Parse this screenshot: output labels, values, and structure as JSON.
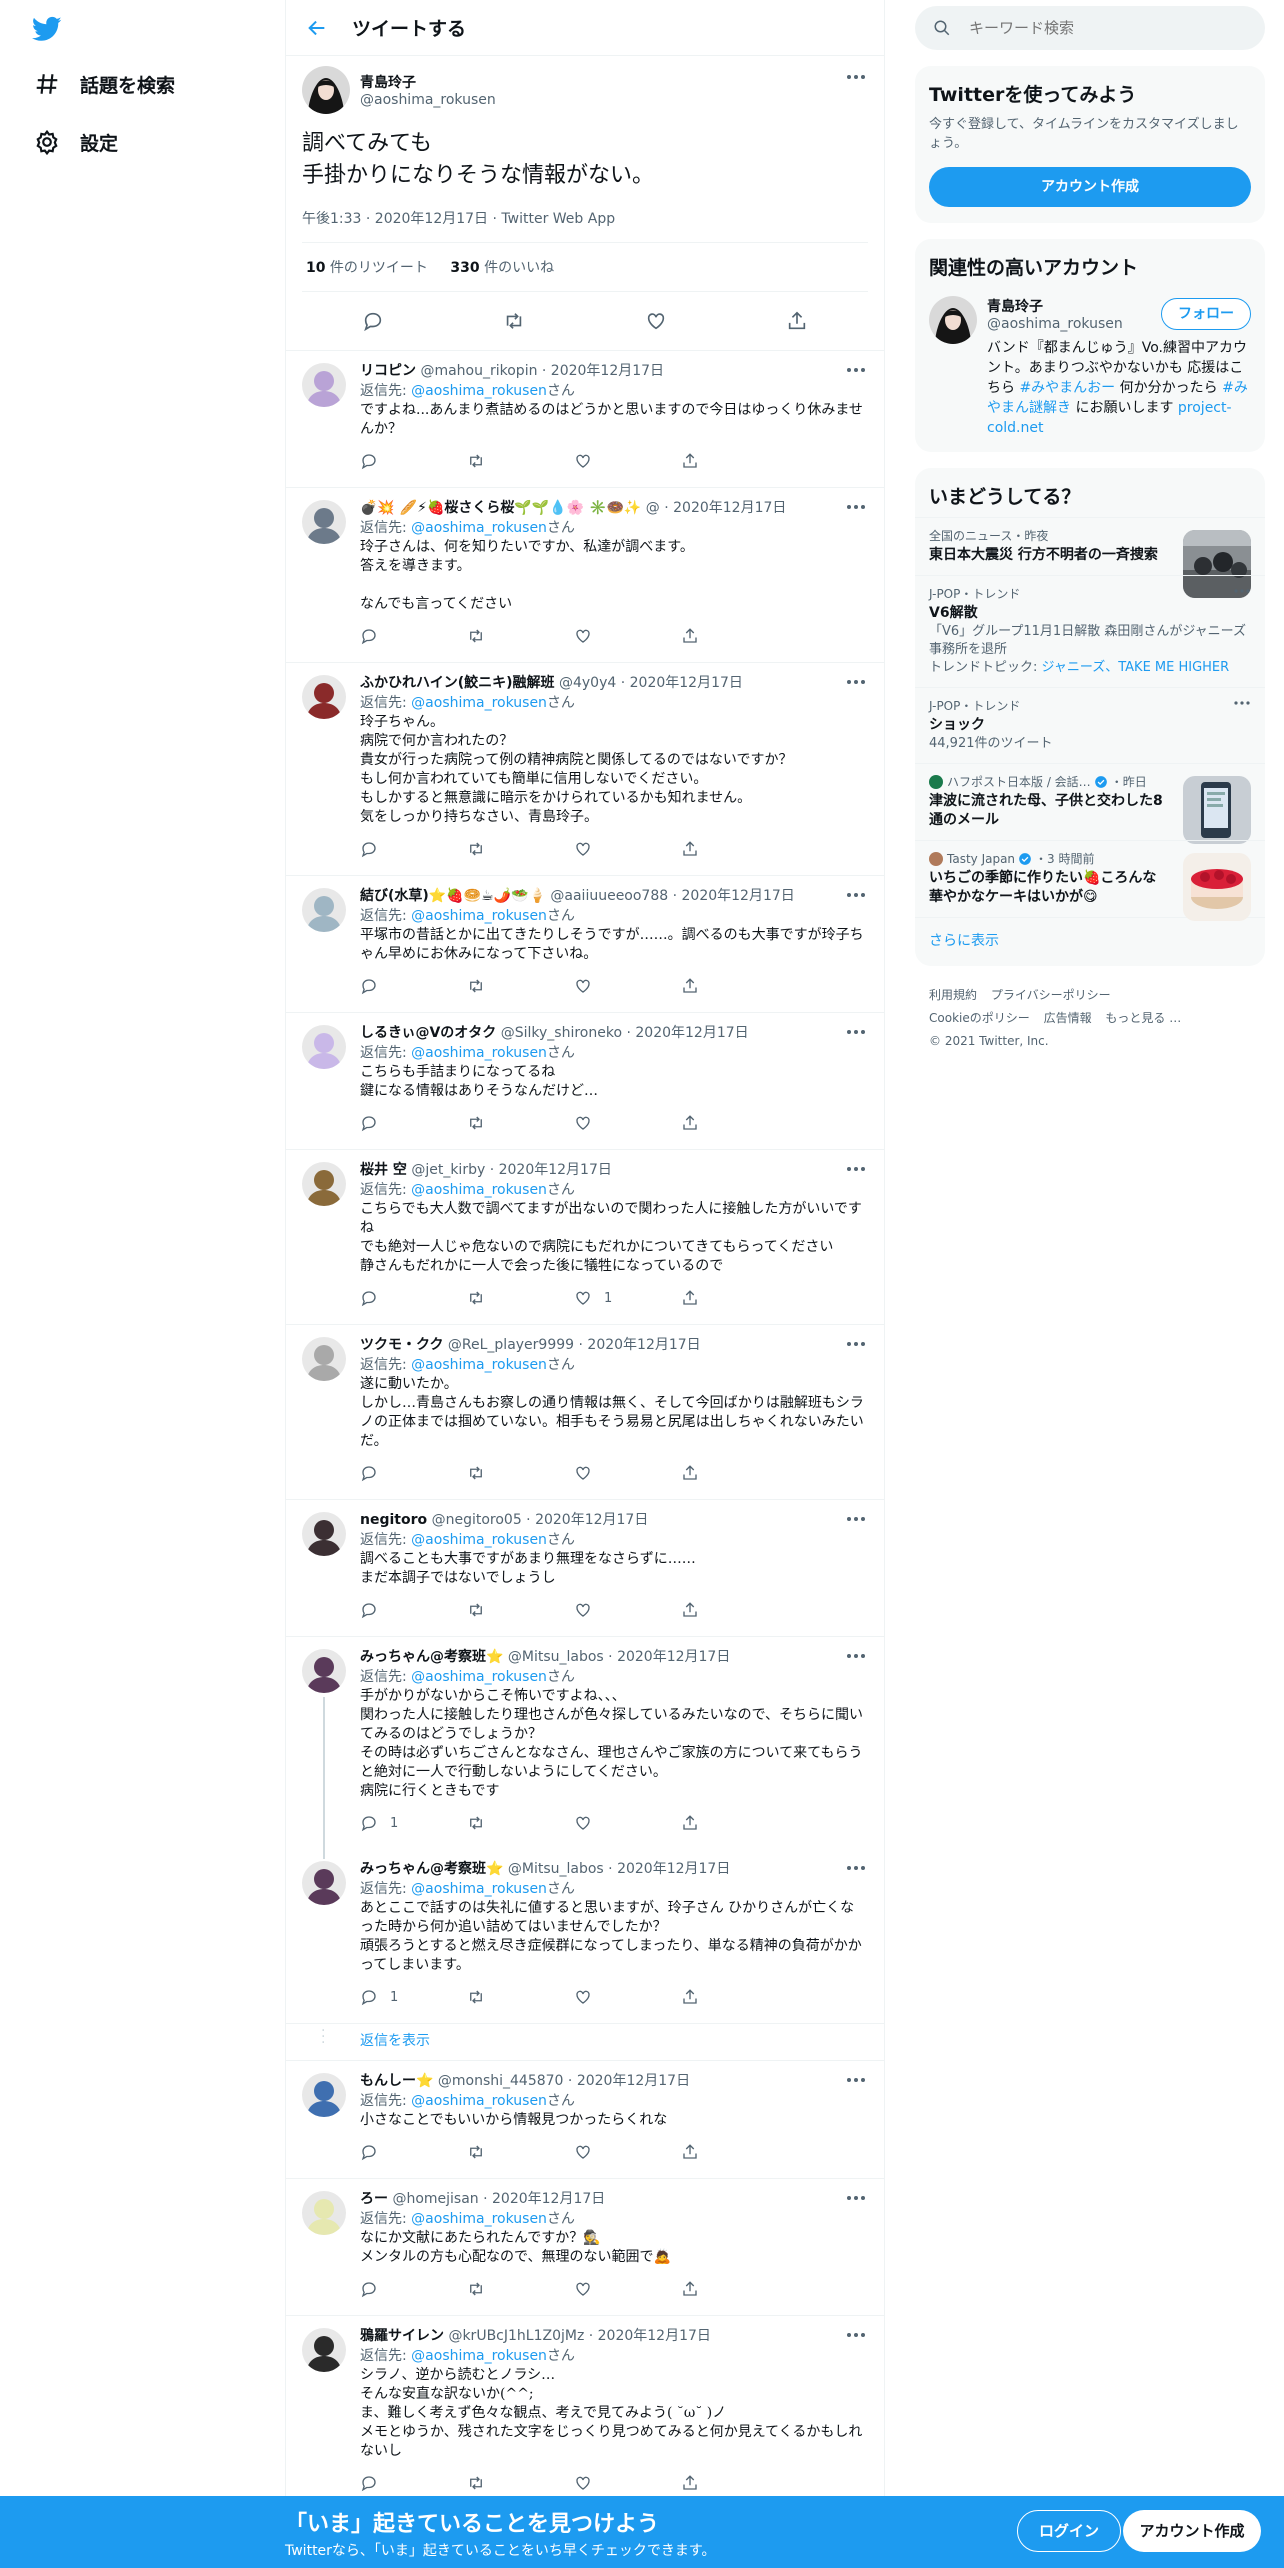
{
  "nav": {
    "logo_icon": "twitter-bird-icon",
    "explore_label": "話題を検索",
    "settings_label": "設定"
  },
  "header": {
    "title": "ツイートする"
  },
  "focal": {
    "name": "青島玲子",
    "handle": "@aoshima_rokusen",
    "text": "調べてみても\n手掛かりになりそうな情報がない。",
    "meta": "午後1:33 · 2020年12月17日 · Twitter Web App",
    "retweets": "10",
    "retweets_label": " 件のリツイート",
    "likes": "330",
    "likes_label": " 件のいいね"
  },
  "reply_prefix": "返信先: ",
  "reply_suffix": "さん",
  "show_replies_label": "返信を表示",
  "tweets": [
    {
      "name": "リコピン",
      "handle": "@mahou_rikopin · 2020年12月17日",
      "reply_to": "@aoshima_rokusen",
      "text": "ですよね...あんまり煮詰めるのはどうかと思いますので今日はゆっくり休みませんか？",
      "reply_count": "",
      "like_count": ""
    },
    {
      "name": "💣💥 🥖⚡🍓桜さくら桜🌱🌱💧🌸 ✳️🍩✨",
      "handle": "@ · 2020年12月17日",
      "reply_to": "@aoshima_rokusen",
      "text": "玲子さんは、何を知りたいですか、私達が調べます。\n答えを導きます。\n\nなんでも言ってください",
      "reply_count": "",
      "like_count": ""
    },
    {
      "name": "ふかひれハイン(鮫ニキ)融解班",
      "handle": "@4y0y4 · 2020年12月17日",
      "reply_to": "@aoshima_rokusen",
      "text": "玲子ちゃん。\n病院で何か言われたの？\n貴女が行った病院って例の精神病院と関係してるのではないですか？\nもし何か言われていても簡単に信用しないでください。\nもしかすると無意識に暗示をかけられているかも知れません。\n気をしっかり持ちなさい、青島玲子。",
      "reply_count": "",
      "like_count": ""
    },
    {
      "name": "結び(水草)⭐🍓🥯☕🌶️🥗🍦",
      "handle": "@aaiiuueeoo788 · 2020年12月17日",
      "reply_to": "@aoshima_rokusen",
      "text": "平塚市の昔話とかに出てきたりしそうですが……。調べるのも大事ですが玲子ちゃん早めにお休みになって下さいね。",
      "reply_count": "",
      "like_count": ""
    },
    {
      "name": "しるきぃ@Vのオタク",
      "handle": "@Silky_shironeko · 2020年12月17日",
      "reply_to": "@aoshima_rokusen",
      "text": "こちらも手詰まりになってるね\n鍵になる情報はありそうなんだけど…",
      "reply_count": "",
      "like_count": ""
    },
    {
      "name": "桜井 空",
      "handle": "@jet_kirby · 2020年12月17日",
      "reply_to": "@aoshima_rokusen",
      "text": "こちらでも大人数で調べてますが出ないので関わった人に接触した方がいいですね\nでも絶対一人じゃ危ないので病院にもだれかについてきてもらってください\n静さんもだれかに一人で会った後に犠牲になっているので",
      "reply_count": "",
      "like_count": "1"
    },
    {
      "name": "ツクモ・クク",
      "handle": "@ReL_player9999 · 2020年12月17日",
      "reply_to": "@aoshima_rokusen",
      "text": "遂に動いたか。\nしかし…青島さんもお察しの通り情報は無く、そして今回ばかりは融解班もシラノの正体までは掴めていない。相手もそう易易と尻尾は出しちゃくれないみたいだ。",
      "reply_count": "",
      "like_count": ""
    },
    {
      "name": "negitoro",
      "handle": "@negitoro05 · 2020年12月17日",
      "reply_to": "@aoshima_rokusen",
      "text": "調べることも大事ですがあまり無理をなさらずに……\nまだ本調子ではないでしょうし",
      "reply_count": "",
      "like_count": ""
    },
    {
      "name": "みっちゃん@考察班⭐",
      "handle": "@Mitsu_labos · 2020年12月17日",
      "reply_to": "@aoshima_rokusen",
      "text": "手がかりがないからこそ怖いですよね、、、\n関わった人に接触したり理也さんが色々探しているみたいなので、そちらに聞いてみるのはどうでしょうか？\nその時は必ずいちごさんとななさん、理也さんやご家族の方について来てもらうと絶対に一人で行動しないようにしてください。\n病院に行くときもです",
      "reply_count": "1",
      "like_count": ""
    },
    {
      "name": "みっちゃん@考察班⭐",
      "handle": "@Mitsu_labos · 2020年12月17日",
      "reply_to": "@aoshima_rokusen",
      "text": "あとここで話すのは失礼に値すると思いますが、玲子さん ひかりさんが亡くなった時から何か追い詰めてはいませんでしたか？\n頑張ろうとすると燃え尽き症候群になってしまったり、単なる精神の負荷がかかってしまいます。",
      "reply_count": "1",
      "like_count": ""
    },
    {
      "name": "もんしー⭐",
      "handle": "@monshi_445870 · 2020年12月17日",
      "reply_to": "@aoshima_rokusen",
      "text": "小さなことでもいいから情報見つかったらくれな",
      "reply_count": "",
      "like_count": ""
    },
    {
      "name": "ろー",
      "handle": "@homejisan · 2020年12月17日",
      "reply_to": "@aoshima_rokusen",
      "text": "なにか文献にあたられたんですか？🕵\nメンタルの方も心配なので、無理のない範囲で🙇",
      "reply_count": "",
      "like_count": ""
    },
    {
      "name": "鴉羅サイレン",
      "handle": "@krUBcJ1hL1Z0jMz · 2020年12月17日",
      "reply_to": "@aoshima_rokusen",
      "text": "シラノ、逆から読むとノラシ…\nそんな安直な訳ないか(^^;\nま、難しく考えず色々な観点、考えで見てみよう( ˘ω˘ )ノ\nメモとゆうか、残された文字をじっくり見つめてみると何か見えてくるかもしれないし",
      "reply_count": "",
      "like_count": ""
    }
  ],
  "search": {
    "placeholder": "キーワード検索"
  },
  "signup_card": {
    "title": "Twitterを使ってみよう",
    "desc": "今すぐ登録して、タイムラインをカスタマイズしましょう。",
    "button": "アカウント作成"
  },
  "related": {
    "title": "関連性の高いアカウント",
    "name": "青島玲子",
    "handle": "@aoshima_rokusen",
    "follow": "フォロー",
    "bio_1": "バンド『都まんじゅう』Vo.練習中アカウント。あまりつぶやかないかも 応援はこちら ",
    "bio_tag1": "#みやまんおー",
    "bio_2": " 何か分かったら ",
    "bio_tag2": "#みやまん謎解き",
    "bio_3": " にお願いします ",
    "bio_link": "project-cold.net"
  },
  "trends": {
    "title": "いまどうしてる？",
    "items": [
      {
        "meta": "全国のニュース・昨夜",
        "title": "東日本大震災 行方不明者の一斉捜索",
        "sub": ""
      },
      {
        "meta": "J-POP・トレンド",
        "title": "V6解散",
        "sub": "「V6」グループ11月1日解散 森田剛さんがジャニーズ事務所を退所",
        "topic_label": "トレンドトピック: ",
        "topic_links": "ジャニーズ、TAKE ME HIGHER"
      },
      {
        "meta": "J-POP・トレンド",
        "title": "ショック",
        "sub": "44,921件のツイート"
      },
      {
        "source": "ハフポスト日本版 / 会話…",
        "time": "・昨日",
        "title": "津波に流された母、子供と交わした8通のメール"
      },
      {
        "source": "Tasty Japan",
        "time": "・3 時間前",
        "title": "いちごの季節に作りたい🍓ころんな華やかなケーキはいかが😋"
      }
    ],
    "show_more": "さらに表示"
  },
  "footer": {
    "terms": "利用規約",
    "privacy": "プライバシーポリシー",
    "cookie": "Cookieのポリシー",
    "ads": "広告情報",
    "more": "もっと見る …",
    "copyright": "© 2021 Twitter, Inc."
  },
  "bottom": {
    "title": "「いま」起きていることを見つけよう",
    "sub": "Twitterなら、「いま」起きていることをいち早くチェックできます。",
    "login": "ログイン",
    "signup": "アカウント作成"
  },
  "colors": {
    "accent": "#1d9bf0",
    "text": "#0f1419",
    "muted": "#536471"
  }
}
